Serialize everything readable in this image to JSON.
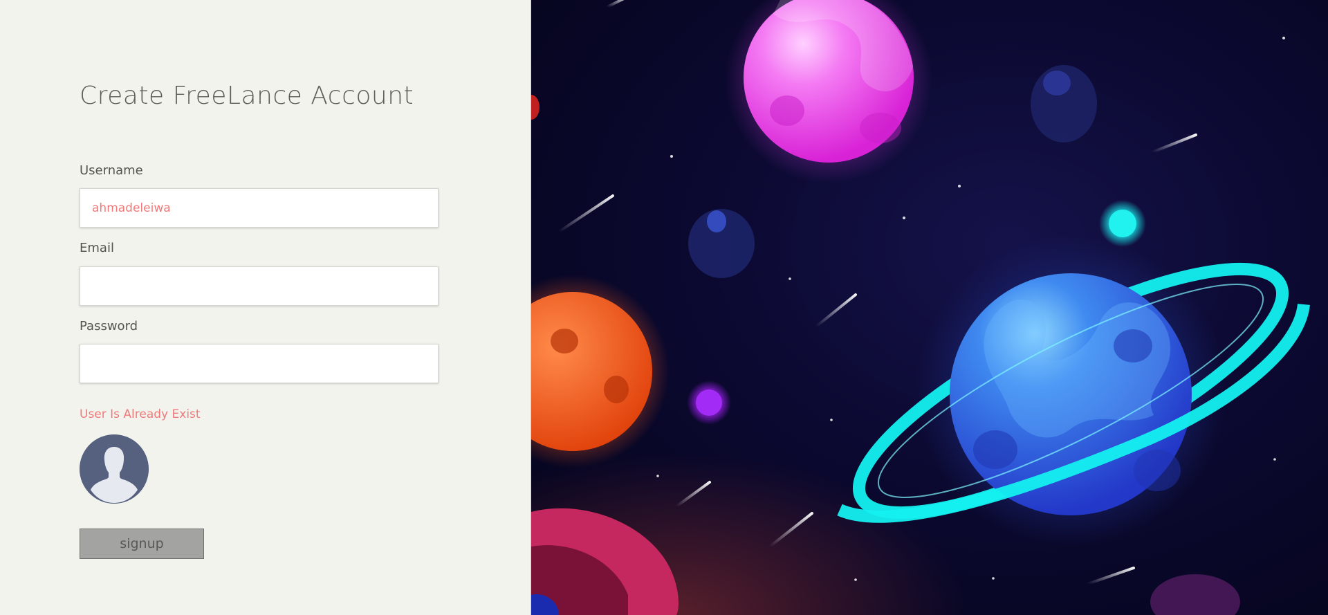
{
  "form": {
    "title": "Create FreeLance Account",
    "username_label": "Username",
    "username_value": "ahmadeleiwa",
    "email_label": "Email",
    "email_value": "",
    "password_label": "Password",
    "password_value": "",
    "error_message": "User Is Already Exist",
    "signup_label": "signup"
  },
  "colors": {
    "panel_background": "#f3f3ee",
    "error_text": "#f07a7a",
    "button_background": "#a3a3a1",
    "avatar_background": "#56607f",
    "space_background": "#0b0930"
  },
  "icons": {
    "avatar": "user-silhouette-icon"
  }
}
